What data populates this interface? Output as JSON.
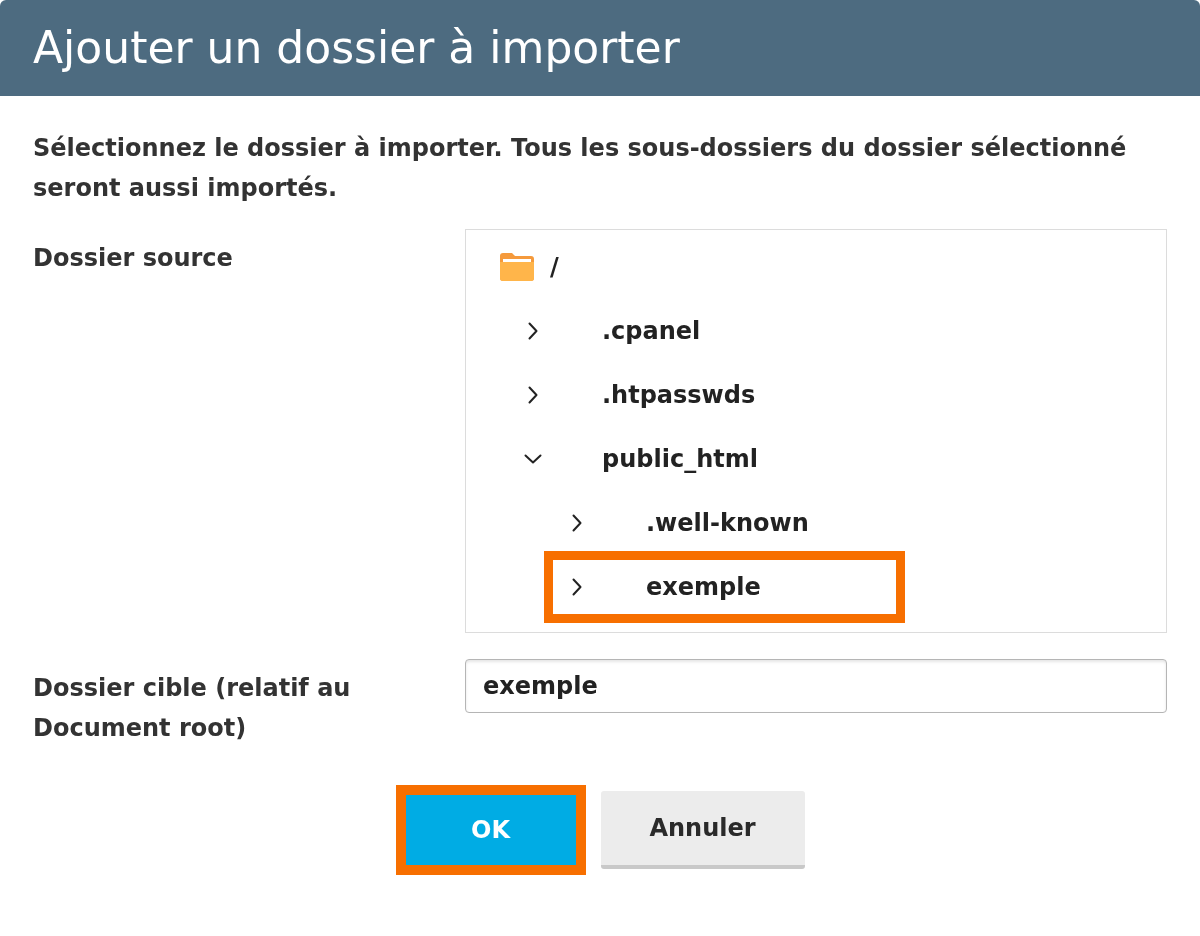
{
  "dialog": {
    "title": "Ajouter un dossier à importer",
    "description": "Sélectionnez le dossier à importer. Tous les sous-dossiers du dossier sélectionné seront aussi importés.",
    "source_folder": {
      "label": "Dossier source",
      "tree": {
        "label": "/",
        "children": [
          {
            "label": ".cpanel",
            "expanded": false,
            "highlighted": false
          },
          {
            "label": ".htpasswds",
            "expanded": false,
            "highlighted": false
          },
          {
            "label": "public_html",
            "expanded": true,
            "highlighted": false,
            "children": [
              {
                "label": ".well-known",
                "expanded": false,
                "highlighted": false
              },
              {
                "label": "exemple",
                "expanded": false,
                "highlighted": true
              }
            ]
          }
        ]
      }
    },
    "target_folder": {
      "label": "Dossier cible (relatif au Document root)",
      "value": "exemple"
    },
    "buttons": [
      {
        "label": "OK",
        "kind": "primary",
        "highlighted": true
      },
      {
        "label": "Annuler",
        "kind": "secondary",
        "highlighted": false
      }
    ]
  }
}
